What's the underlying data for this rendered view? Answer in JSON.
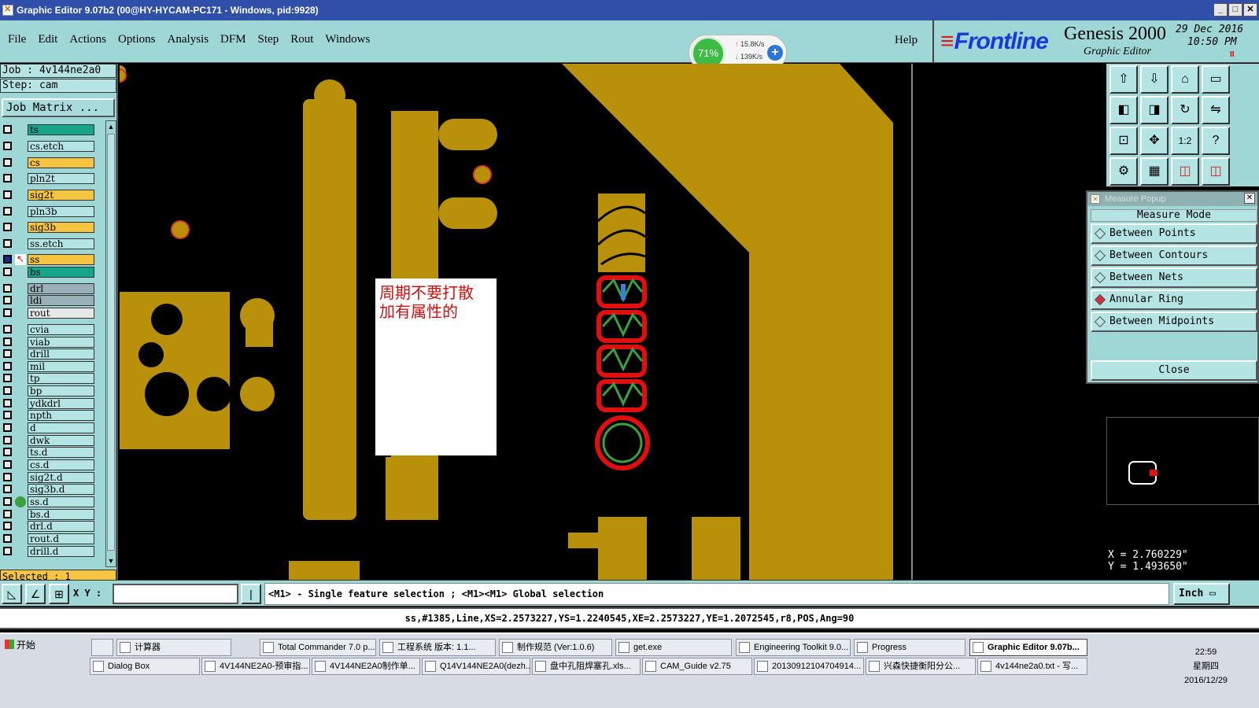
{
  "window": {
    "title": "Graphic Editor 9.07b2 (00@HY-HYCAM-PC171 - Windows, pid:9928)",
    "buttons": [
      "_",
      "□",
      "✕"
    ]
  },
  "menu": {
    "items": [
      "File",
      "Edit",
      "Actions",
      "Options",
      "Analysis",
      "DFM",
      "Step",
      "Rout",
      "Windows"
    ],
    "help": "Help"
  },
  "netmeter": {
    "percent": "71%",
    "up": "15.8K/s",
    "down": "139K/s",
    "plus": "+"
  },
  "brand": {
    "logo": "Frontline",
    "product": "Genesis 2000",
    "subtitle": "Graphic Editor",
    "date": "29 Dec 2016",
    "time": "10:50 PM",
    "pause": "II"
  },
  "left": {
    "job": "Job : 4v144ne2a0",
    "step": "Step: cam",
    "job_matrix": "Job Matrix ...",
    "selected": "Selected : 1",
    "layers": [
      {
        "name": "ts",
        "color": "#17a589"
      },
      {
        "name": "cs.etch",
        "color": "#b4e4e4"
      },
      {
        "name": "cs",
        "color": "#f5c542"
      },
      {
        "name": "pln2t",
        "color": "#b4e4e4"
      },
      {
        "name": "sig2t",
        "color": "#f5c542"
      },
      {
        "name": "pln3b",
        "color": "#b4e4e4"
      },
      {
        "name": "sig3b",
        "color": "#f5c542"
      },
      {
        "name": "ss.etch",
        "color": "#b4e4e4"
      },
      {
        "name": "ss",
        "color": "#f5c542",
        "flag": "red-arrow"
      },
      {
        "name": "bs",
        "color": "#17a589"
      },
      {
        "name": "drl",
        "color": "#9ab0b8"
      },
      {
        "name": "ldi",
        "color": "#9ab0b8"
      },
      {
        "name": "rout",
        "color": "#e8e8e8"
      },
      {
        "name": "cvia",
        "color": "#b4e4e4"
      },
      {
        "name": "viab",
        "color": "#b4e4e4"
      },
      {
        "name": "drill",
        "color": "#b4e4e4"
      },
      {
        "name": "mil",
        "color": "#b4e4e4"
      },
      {
        "name": "tp",
        "color": "#b4e4e4"
      },
      {
        "name": "bp",
        "color": "#b4e4e4"
      },
      {
        "name": "ydkdrl",
        "color": "#b4e4e4"
      },
      {
        "name": "npth",
        "color": "#b4e4e4"
      },
      {
        "name": "d",
        "color": "#b4e4e4"
      },
      {
        "name": "dwk",
        "color": "#b4e4e4"
      },
      {
        "name": "ts.d",
        "color": "#b4e4e4"
      },
      {
        "name": "cs.d",
        "color": "#b4e4e4"
      },
      {
        "name": "sig2t.d",
        "color": "#b4e4e4"
      },
      {
        "name": "sig3b.d",
        "color": "#b4e4e4"
      },
      {
        "name": "ss.d",
        "color": "#b4e4e4",
        "flag": "green-dot"
      },
      {
        "name": "bs.d",
        "color": "#b4e4e4"
      },
      {
        "name": "drl.d",
        "color": "#b4e4e4"
      },
      {
        "name": "rout.d",
        "color": "#b4e4e4"
      },
      {
        "name": "drill.d",
        "color": "#b4e4e4"
      }
    ]
  },
  "canvas": {
    "note": "周期不要打散　加有属性的",
    "copper_color": "#b8900a"
  },
  "measure": {
    "title": "Measure Popup",
    "mode_label": "Measure Mode",
    "options": [
      {
        "label": "Between Points",
        "selected": false
      },
      {
        "label": "Between Contours",
        "selected": false
      },
      {
        "label": "Between Nets",
        "selected": false
      },
      {
        "label": "Annular Ring",
        "selected": true
      },
      {
        "label": "Between Midpoints",
        "selected": false
      }
    ],
    "close": "Close"
  },
  "coords": {
    "x": "X = 2.760229\"",
    "y": "Y = 1.493650\""
  },
  "command": {
    "xy_label": "X Y :",
    "xy_value": "",
    "prompt": "<M1> - Single feature selection ; <M1><M1> Global selection",
    "unit": "Inch",
    "status": "ss,#1385,Line,XS=2.2573227,YS=1.2240545,XE=2.2573227,YE=1.2072545,r8,POS,Ang=90"
  },
  "taskbar": {
    "start": "开始",
    "row1": [
      "计算器",
      "Total Commander 7.0 p...",
      "工程系统  版本: 1.1...",
      "制作规范 (Ver:1.0.6)",
      "get.exe",
      "Engineering Toolkit 9.0...",
      "Progress",
      "Graphic Editor 9.07b..."
    ],
    "row2": [
      "Dialog Box",
      "4V144NE2A0-预审指...",
      "4V144NE2A0制作单...",
      "Q14V144NE2A0(dezh...",
      "盘中孔阻焊塞孔.xls...",
      "CAM_Guide v2.75",
      "20130912104704914...",
      "兴森快捷衡阳分公...",
      "4v144ne2a0.txt - 写..."
    ],
    "clock_time": "22:59",
    "clock_day": "星期四",
    "clock_date": "2016/12/29"
  }
}
